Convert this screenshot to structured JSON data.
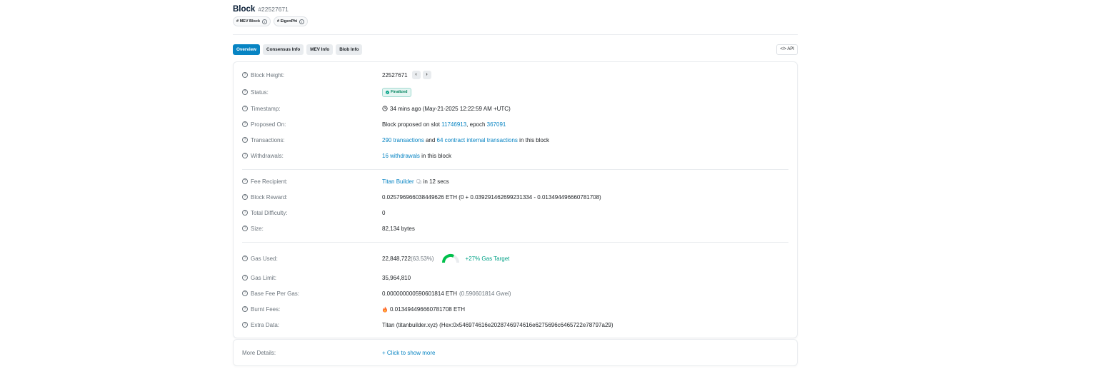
{
  "header": {
    "title": "Block",
    "block_number": "#22527671"
  },
  "badges": [
    {
      "label": "# MEV Block"
    },
    {
      "label": "# EigenPhi"
    }
  ],
  "tabs": [
    {
      "label": "Overview",
      "active": true
    },
    {
      "label": "Consensus Info",
      "active": false
    },
    {
      "label": "MEV Info",
      "active": false
    },
    {
      "label": "Blob Info",
      "active": false
    }
  ],
  "api_label": "</> API",
  "rows": {
    "block_height": {
      "label": "Block Height:",
      "value": "22527671"
    },
    "status": {
      "label": "Status:",
      "value": "Finalized"
    },
    "timestamp": {
      "label": "Timestamp:",
      "value": "34 mins ago (May-21-2025 12:22:59 AM +UTC)"
    },
    "proposed_on": {
      "label": "Proposed On:",
      "prefix": "Block proposed on slot",
      "slot": "11746913",
      "mid": ", epoch",
      "epoch": "367091"
    },
    "transactions": {
      "label": "Transactions:",
      "tx_link": "290 transactions",
      "and": "and",
      "internal_link": "64 contract internal transactions",
      "suffix": "in this block"
    },
    "withdrawals": {
      "label": "Withdrawals:",
      "link": "16 withdrawals",
      "suffix": "in this block"
    },
    "fee_recipient": {
      "label": "Fee Recipient:",
      "link": "Titan Builder",
      "suffix": "in 12 secs"
    },
    "block_reward": {
      "label": "Block Reward:",
      "value": "0.025796966038449626 ETH (0 + 0.039291462699231334 - 0.013494496660781708)"
    },
    "total_difficulty": {
      "label": "Total Difficulty:",
      "value": "0"
    },
    "size": {
      "label": "Size:",
      "value": "82,134 bytes"
    },
    "gas_used": {
      "label": "Gas Used:",
      "value": "22,848,722",
      "percent": "(63.53%)",
      "target": "+27% Gas Target",
      "fraction": 0.6353
    },
    "gas_limit": {
      "label": "Gas Limit:",
      "value": "35,964,810"
    },
    "base_fee": {
      "label": "Base Fee Per Gas:",
      "value": "0.000000000590601814 ETH",
      "gwei": "(0.590601814 Gwei)"
    },
    "burnt_fees": {
      "label": "Burnt Fees:",
      "value": "0.013494496660781708 ETH"
    },
    "extra_data": {
      "label": "Extra Data:",
      "value": "Titan (titanbuilder.xyz) (Hex:0x546974616e2028746974616e6275696c6465722e78797a29)"
    }
  },
  "more_details": {
    "label": "More Details:",
    "link": "+ Click to show more"
  },
  "colors": {
    "accent": "#0784c3",
    "success": "#00a186",
    "muted": "#6c757d",
    "gauge": "#00c04b"
  }
}
